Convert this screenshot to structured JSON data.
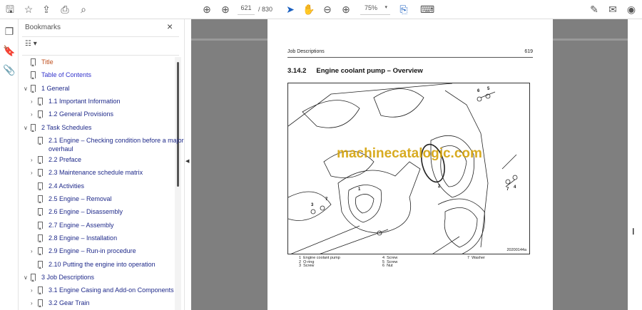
{
  "toolbar": {
    "page_current": "621",
    "page_total": "/ 830",
    "zoom": "75%"
  },
  "panel": {
    "title": "Bookmarks",
    "close": "×"
  },
  "bookmarks": [
    {
      "label": "Title",
      "level": 0,
      "chev": "",
      "color": "#c0501f"
    },
    {
      "label": "Table of Contents",
      "level": 0,
      "chev": "",
      "color": "#3333cc"
    },
    {
      "label": "1 General",
      "level": 0,
      "chev": "∨"
    },
    {
      "label": "1.1 Important Information",
      "level": 1,
      "chev": "›"
    },
    {
      "label": "1.2 General Provisions",
      "level": 1,
      "chev": "›"
    },
    {
      "label": "2 Task Schedules",
      "level": 0,
      "chev": "∨"
    },
    {
      "label": "2.1 Engine – Checking condition before a major",
      "label2": "overhaul",
      "level": 1,
      "chev": ""
    },
    {
      "label": "2.2 Preface",
      "level": 1,
      "chev": "›"
    },
    {
      "label": "2.3 Maintenance schedule matrix",
      "level": 1,
      "chev": "›"
    },
    {
      "label": "2.4 Activities",
      "level": 1,
      "chev": ""
    },
    {
      "label": "2.5 Engine – Removal",
      "level": 1,
      "chev": ""
    },
    {
      "label": "2.6 Engine – Disassembly",
      "level": 1,
      "chev": ""
    },
    {
      "label": "2.7 Engine – Assembly",
      "level": 1,
      "chev": ""
    },
    {
      "label": "2.8 Engine – Installation",
      "level": 1,
      "chev": ""
    },
    {
      "label": "2.9 Engine – Run-in procedure",
      "level": 1,
      "chev": "›"
    },
    {
      "label": "2.10 Putting the engine into operation",
      "level": 1,
      "chev": ""
    },
    {
      "label": "3 Job Descriptions",
      "level": 0,
      "chev": "∨"
    },
    {
      "label": "3.1 Engine Casing and Add-on Components",
      "level": 1,
      "chev": "›"
    },
    {
      "label": "3.2 Gear Train",
      "level": 1,
      "chev": "›"
    }
  ],
  "document": {
    "header_left": "Job Descriptions",
    "header_right": "619",
    "heading_num": "3.14.2",
    "heading": "Engine coolant pump – Overview",
    "figure_id": "20200144a",
    "watermark": "machinecatalogic.com",
    "callouts": [
      "1",
      "2",
      "3",
      "4",
      "5",
      "6",
      "7"
    ],
    "legend": [
      [
        "1",
        "Engine coolant pump"
      ],
      [
        "2",
        "O-ring"
      ],
      [
        "3",
        "Screw"
      ],
      [
        "4",
        "Screw"
      ],
      [
        "5",
        "Screw"
      ],
      [
        "6",
        "Nut"
      ],
      [
        "7",
        "Washer"
      ]
    ]
  }
}
